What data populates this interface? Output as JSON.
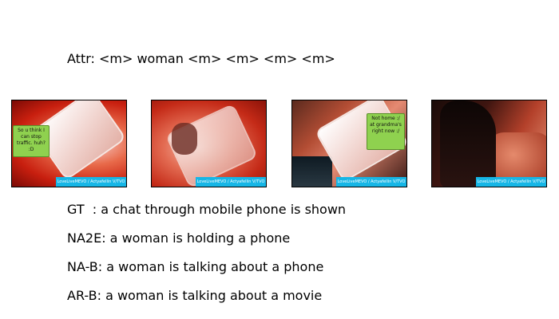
{
  "attr": {
    "text": "Attr: <m> woman <m> <m> <m> <m>"
  },
  "frames": [
    {
      "bubble_text": "So u think I can stop traffic. huh? :D",
      "caption": "LoveLiveMEVO / Actyafellin V/TVO"
    },
    {
      "bubble_text": "",
      "caption": "LoveLiveMEVO / Actyafellin V/TVO"
    },
    {
      "bubble_text": "Not home :/ at grandma's right now :/",
      "caption": "LoveLiveMEVO / Actyafellin V/TVO"
    },
    {
      "bubble_text": "",
      "caption": "LoveLiveMEVO / Actyafellin V/TVO"
    }
  ],
  "captions": {
    "gt": "GT  : a chat through mobile phone is shown",
    "na2e": "NA2E: a woman is holding a phone",
    "nab": "NA-B: a woman is talking about a phone",
    "arb": "AR-B: a woman is talking about a movie"
  }
}
